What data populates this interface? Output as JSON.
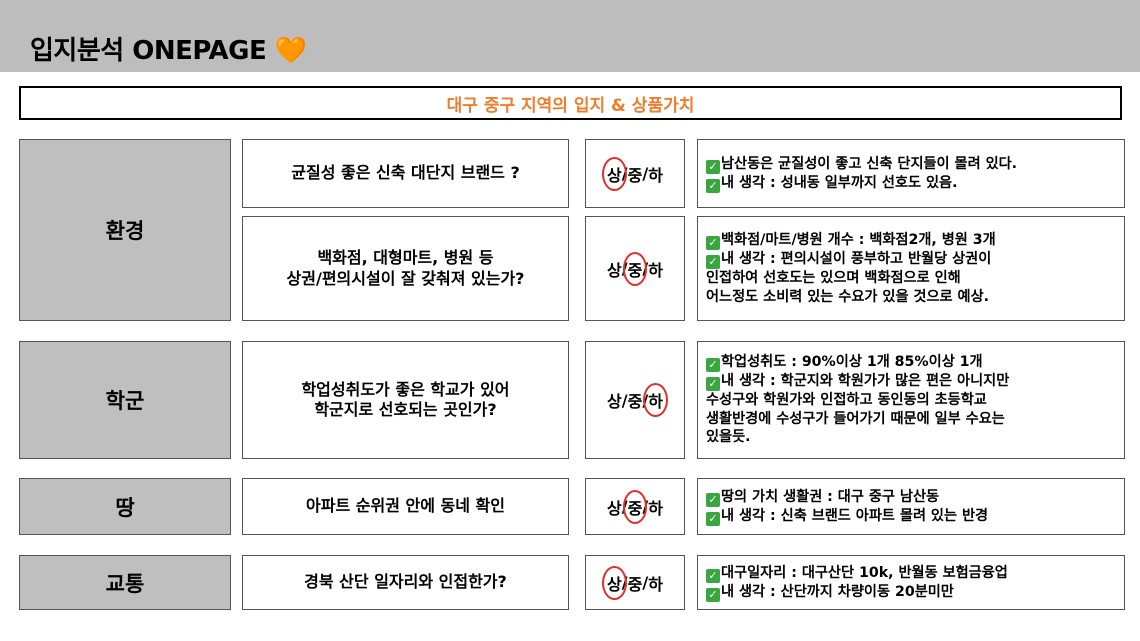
{
  "header": {
    "title": "입지분석 ONEPAGE",
    "emoji": "🧡"
  },
  "subtitle": "대구 중구 지역의 입지 & 상품가치",
  "rating_sep": "/",
  "sections": [
    {
      "category": "환경",
      "rows": [
        {
          "question": [
            "균질성 좋은 신축 대단지 브랜드 ?"
          ],
          "options": [
            "상",
            "중",
            "하"
          ],
          "selected": 0,
          "notes": [
            "남산동은 균질성이 좋고 신축 단지들이 몰려 있다.",
            "내 생각 : 성내동 일부까지 선호도 있음."
          ],
          "check": [
            true,
            true
          ]
        },
        {
          "question": [
            "백화점, 대형마트, 병원 등",
            "상권/편의시설이 잘 갖춰져 있는가?"
          ],
          "options": [
            "상",
            "중",
            "하"
          ],
          "selected": 1,
          "notes": [
            "백화점/마트/병원 개수 : 백화점2개, 병원 3개",
            "내 생각 : 편의시설이 풍부하고 반월당 상권이",
            "인접하여 선호도는 있으며 백화점으로 인해",
            "어느정도 소비력 있는 수요가 있을 것으로 예상."
          ],
          "check": [
            true,
            true,
            false,
            false
          ]
        }
      ]
    },
    {
      "category": "학군",
      "rows": [
        {
          "question": [
            "학업성취도가 좋은 학교가 있어",
            "학군지로 선호되는 곳인가?"
          ],
          "options": [
            "상",
            "중",
            "하"
          ],
          "selected": 2,
          "notes": [
            "학업성취도 : 90%이상 1개 85%이상 1개",
            "내 생각 : 학군지와 학원가가 많은 편은 아니지만",
            "수성구와 학원가와 인접하고 동인동의 초등학교",
            "생활반경에 수성구가 들어가기 때문에 일부 수요는",
            "있을듯."
          ],
          "check": [
            true,
            true,
            false,
            false,
            false
          ]
        }
      ]
    },
    {
      "category": "땅",
      "rows": [
        {
          "question": [
            "아파트 순위권 안에 동네 확인"
          ],
          "options": [
            "상",
            "중",
            "하"
          ],
          "selected": 1,
          "notes": [
            "땅의 가치 생활권 : 대구 중구 남산동",
            "내 생각 : 신축 브랜드 아파트 몰려 있는 반경"
          ],
          "check": [
            true,
            true
          ]
        }
      ]
    },
    {
      "category": "교통",
      "rows": [
        {
          "question": [
            "경북 산단 일자리와 인접한가?"
          ],
          "options": [
            "상",
            "중",
            "하"
          ],
          "selected": 0,
          "notes": [
            "대구일자리 : 대구산단 10k, 반월동 보험금융업",
            "내 생각 : 산단까지 차량이동 20분미만"
          ],
          "check": [
            true,
            true
          ]
        }
      ]
    }
  ]
}
